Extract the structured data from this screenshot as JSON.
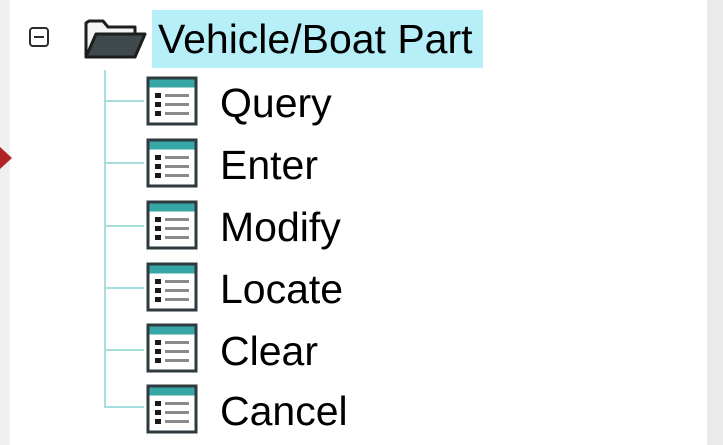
{
  "tree": {
    "root": {
      "label": "Vehicle/Boat Part",
      "icon": "folder-open-icon",
      "expanded": true,
      "selected": true
    },
    "items": [
      {
        "label": "Query",
        "icon": "form-icon"
      },
      {
        "label": "Enter",
        "icon": "form-icon"
      },
      {
        "label": "Modify",
        "icon": "form-icon"
      },
      {
        "label": "Locate",
        "icon": "form-icon"
      },
      {
        "label": "Clear",
        "icon": "form-icon"
      },
      {
        "label": "Cancel",
        "icon": "form-icon"
      }
    ]
  },
  "colors": {
    "selection_highlight": "#b6eff7",
    "tree_lines": "#a8dede",
    "marker": "#b32222"
  }
}
